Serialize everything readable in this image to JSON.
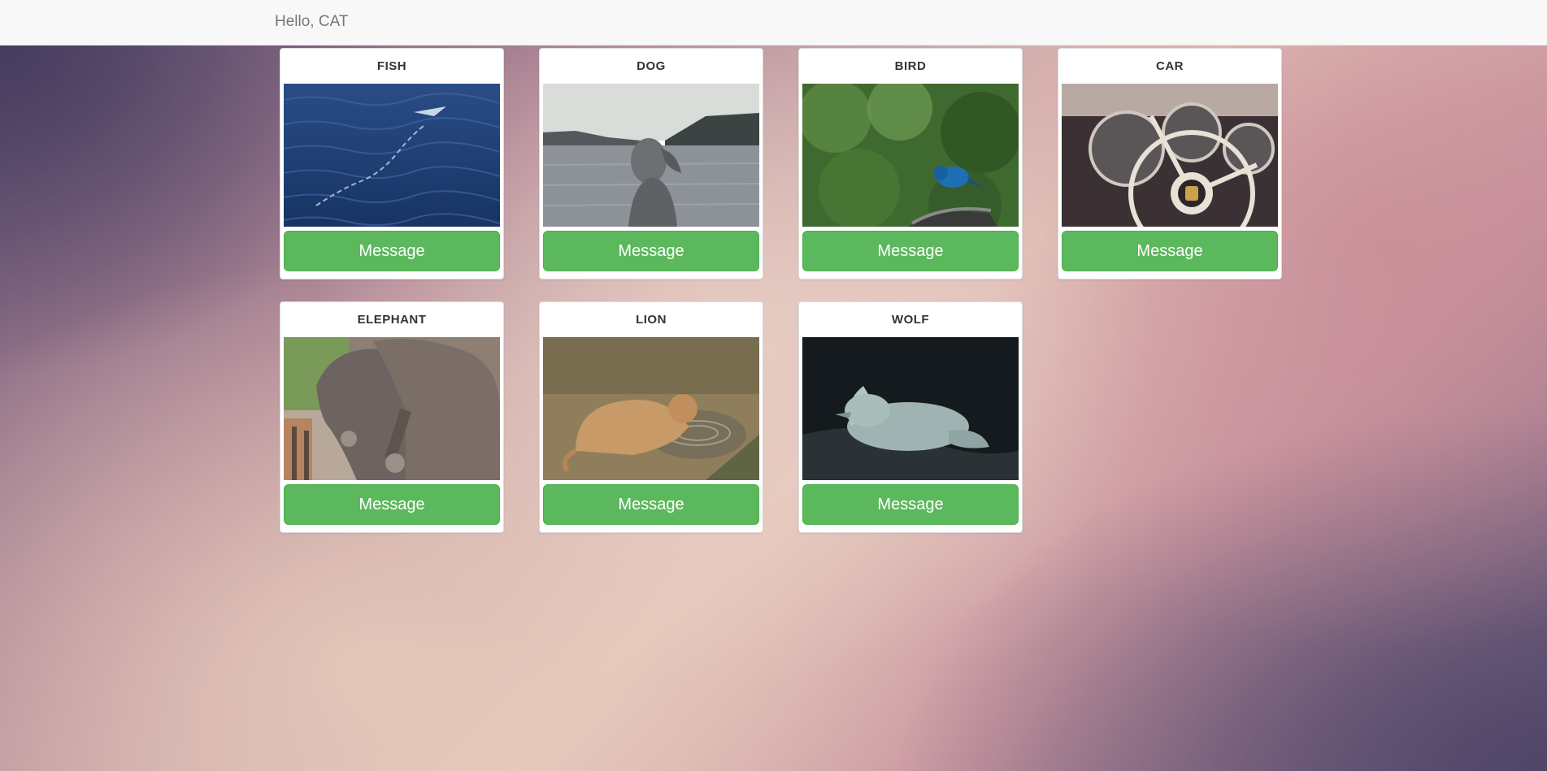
{
  "navbar": {
    "brand": "Hello, CAT"
  },
  "cards": [
    {
      "title": "FISH",
      "image": "fish-photo",
      "button_label": "Message"
    },
    {
      "title": "DOG",
      "image": "dog-photo",
      "button_label": "Message"
    },
    {
      "title": "BIRD",
      "image": "bird-photo",
      "button_label": "Message"
    },
    {
      "title": "CAR",
      "image": "car-photo",
      "button_label": "Message"
    },
    {
      "title": "ELEPHANT",
      "image": "elephant-photo",
      "button_label": "Message"
    },
    {
      "title": "LION",
      "image": "lion-photo",
      "button_label": "Message"
    },
    {
      "title": "WOLF",
      "image": "wolf-photo",
      "button_label": "Message"
    }
  ],
  "colors": {
    "button": "#5cb85c",
    "navbar": "#f8f8f8",
    "brand_text": "#777777"
  }
}
